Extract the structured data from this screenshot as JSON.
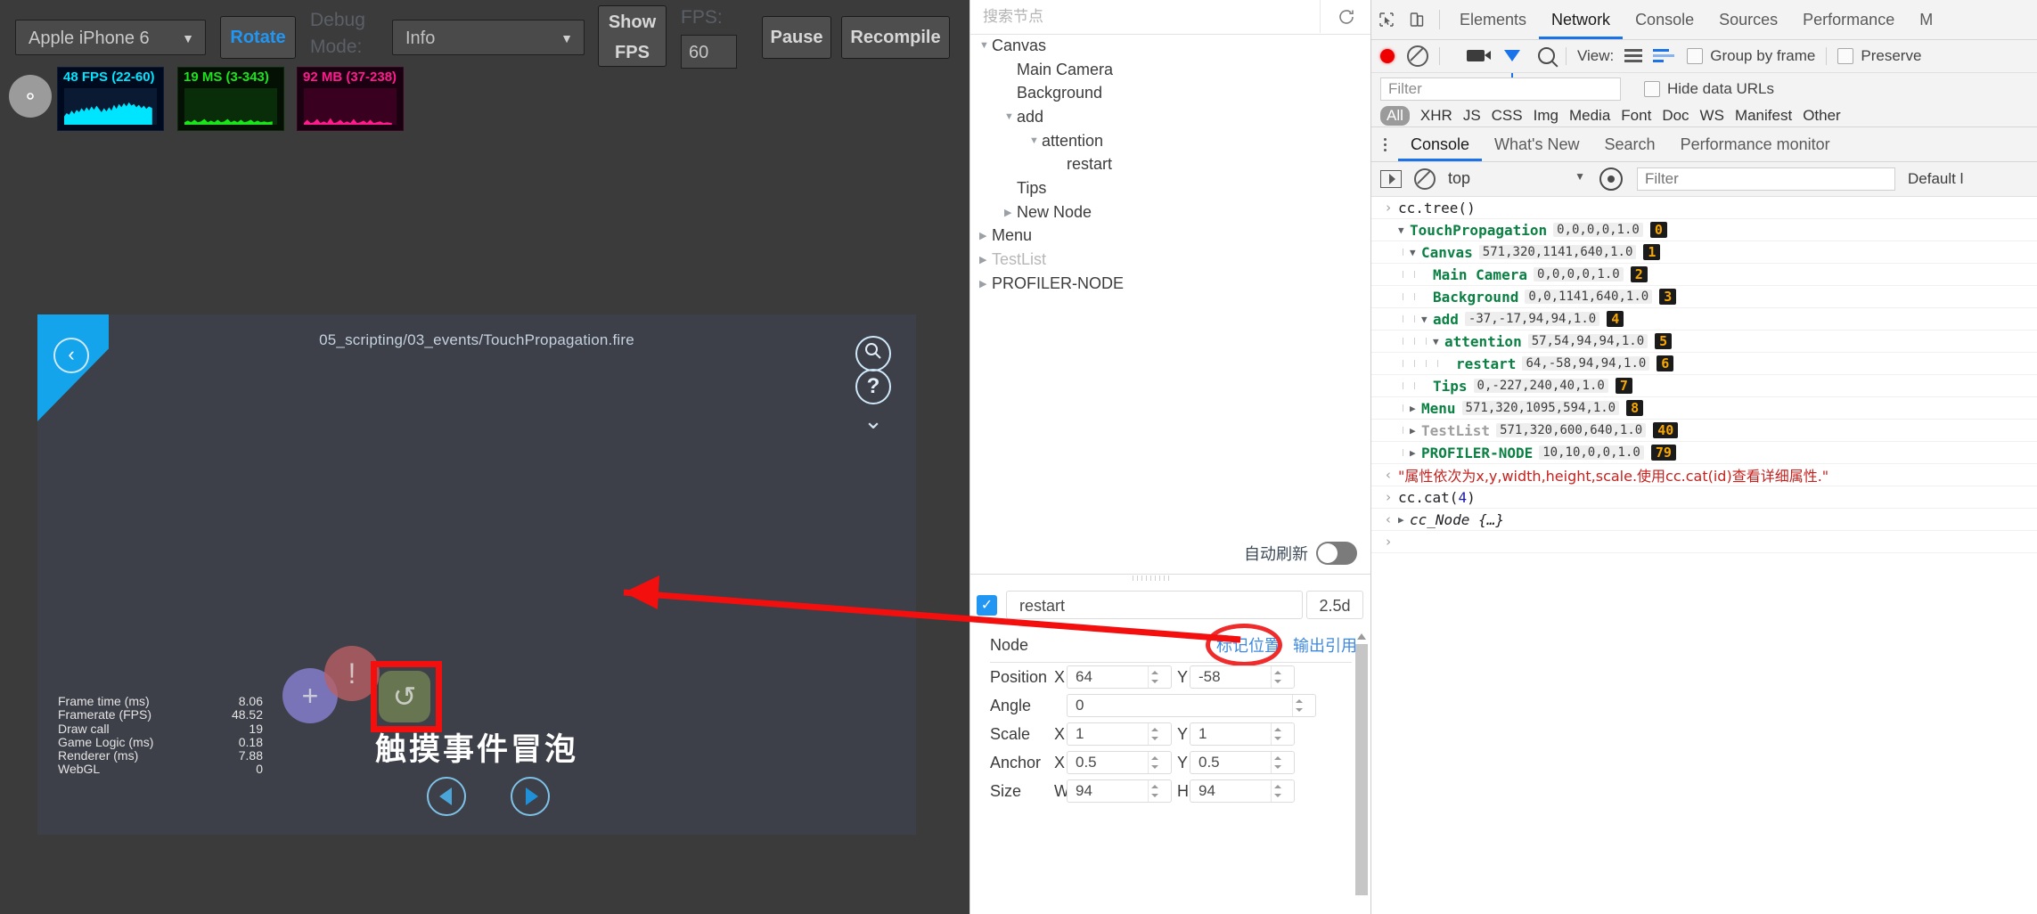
{
  "simulator": {
    "toolbar": {
      "device_value": "Apple iPhone 6",
      "rotate_label": "Rotate",
      "debug_mode_label": "Debug Mode:",
      "mode_value": "Info",
      "show_fps_label": "Show FPS",
      "fps_label": "FPS:",
      "fps_value": "60",
      "pause_label": "Pause",
      "recompile_label": "Recompile",
      "caret": "▼",
      "gear_icon": "gear-icon"
    },
    "stat_graphs": [
      {
        "caption": "48 FPS (22-60)",
        "color": "#00e5ff",
        "bg": "#000a1e"
      },
      {
        "caption": "19 MS (3-343)",
        "color": "#1ae51a",
        "bg": "#031003"
      },
      {
        "caption": "92 MB (37-238)",
        "color": "#ff1b8d",
        "bg": "#1a0010"
      }
    ],
    "game": {
      "scene_path": "05_scripting/03_events/TouchPropagation.fire",
      "back_icon": "chevron-left-icon",
      "search_icon": "search-icon",
      "help_icon": "question-mark-icon",
      "chevron_icon": "chevron-down-icon",
      "bubble_plus": "+",
      "bubble_exclaim": "!",
      "bubble_restart": "↺",
      "title": "触摸事件冒泡",
      "prev_icon": "triangle-left-icon",
      "next_icon": "triangle-right-icon",
      "stats": [
        {
          "key": "Frame time (ms)",
          "value": "8.06"
        },
        {
          "key": "Framerate (FPS)",
          "value": "48.52"
        },
        {
          "key": "Draw call",
          "value": "19"
        },
        {
          "key": "Game Logic (ms)",
          "value": "0.18"
        },
        {
          "key": "Renderer (ms)",
          "value": "7.88"
        },
        {
          "key": "WebGL",
          "value": "0"
        }
      ],
      "highlight_color": "#f40f0f"
    }
  },
  "inspector": {
    "search_placeholder": "搜索节点",
    "search_value": "",
    "refresh_icon": "refresh-icon",
    "tree": [
      {
        "label": "Canvas",
        "indent": 0,
        "twisty": "▼",
        "dim": false
      },
      {
        "label": "Main Camera",
        "indent": 1,
        "twisty": "",
        "dim": false
      },
      {
        "label": "Background",
        "indent": 1,
        "twisty": "",
        "dim": false
      },
      {
        "label": "add",
        "indent": 1,
        "twisty": "▼",
        "dim": false
      },
      {
        "label": "attention",
        "indent": 2,
        "twisty": "▼",
        "dim": false
      },
      {
        "label": "restart",
        "indent": 3,
        "twisty": "",
        "dim": false
      },
      {
        "label": "Tips",
        "indent": 1,
        "twisty": "",
        "dim": false
      },
      {
        "label": "New Node",
        "indent": 1,
        "twisty": "▶",
        "dim": false
      },
      {
        "label": "Menu",
        "indent": 0,
        "twisty": "▶",
        "dim": false
      },
      {
        "label": "TestList",
        "indent": 0,
        "twisty": "▶",
        "dim": true
      },
      {
        "label": "PROFILER-NODE",
        "indent": 0,
        "twisty": "▶",
        "dim": false
      }
    ],
    "auto_refresh_label": "自动刷新",
    "auto_refresh_on": false,
    "props": {
      "enabled": true,
      "check_glyph": "✓",
      "node_name": "restart",
      "dimension_mode": "2.5d",
      "section_title": "Node",
      "link_mark_position": "标记位置",
      "link_export_ref": "输出引用",
      "rows": [
        {
          "label": "Position",
          "fields": [
            {
              "axis": "X",
              "value": "64"
            },
            {
              "axis": "Y",
              "value": "-58"
            }
          ]
        },
        {
          "label": "Angle",
          "fields": [
            {
              "axis": "",
              "value": "0"
            }
          ]
        },
        {
          "label": "Scale",
          "fields": [
            {
              "axis": "X",
              "value": "1"
            },
            {
              "axis": "Y",
              "value": "1"
            }
          ]
        },
        {
          "label": "Anchor",
          "fields": [
            {
              "axis": "X",
              "value": "0.5"
            },
            {
              "axis": "Y",
              "value": "0.5"
            }
          ]
        },
        {
          "label": "Size",
          "fields": [
            {
              "axis": "W",
              "value": "94"
            },
            {
              "axis": "H",
              "value": "94"
            }
          ]
        }
      ]
    }
  },
  "devtools": {
    "inspect_icon": "cursor-select-icon",
    "device_icon": "device-toolbar-icon",
    "tabs": [
      {
        "label": "Elements",
        "active": false
      },
      {
        "label": "Network",
        "active": true
      },
      {
        "label": "Console",
        "active": false
      },
      {
        "label": "Sources",
        "active": false
      },
      {
        "label": "Performance",
        "active": false
      },
      {
        "label": "M",
        "active": false
      }
    ],
    "network_controls": {
      "record_icon": "record-icon",
      "clear_icon": "clear-icon",
      "capture_screenshots_icon": "camera-icon",
      "filter_icon": "funnel-icon",
      "search_icon": "search-icon",
      "view_label": "View:",
      "list_view_icon": "list-view-icon",
      "waterfall_view_icon": "waterfall-view-icon",
      "group_by_frame_label": "Group by frame",
      "group_by_frame_checked": false,
      "preserve_label": "Preserve",
      "preserve_checked": false
    },
    "filter_placeholder": "Filter",
    "filter_value": "",
    "hide_data_urls_label": "Hide data URLs",
    "hide_data_urls_checked": false,
    "resource_types": [
      "All",
      "XHR",
      "JS",
      "CSS",
      "Img",
      "Media",
      "Font",
      "Doc",
      "WS",
      "Manifest",
      "Other"
    ],
    "drawer_tabs": [
      {
        "label": "Console",
        "active": true
      },
      {
        "label": "What's New",
        "active": false
      },
      {
        "label": "Search",
        "active": false
      },
      {
        "label": "Performance monitor",
        "active": false
      }
    ],
    "console_controls": {
      "exec_icon": "execution-context-icon",
      "clear_icon": "clear-console-icon",
      "context_value": "top",
      "context_caret": "▼",
      "eye_icon": "live-expression-icon",
      "filter_placeholder": "Filter",
      "filter_value": "",
      "level_label": "Default l"
    },
    "console_lines": [
      {
        "type": "input",
        "gutter": "›",
        "text": "cc.tree()"
      },
      {
        "type": "node",
        "gutter": "",
        "twisty": "▼",
        "depth": 0,
        "name": "TouchPropagation",
        "meta": "0,0,0,0,1.0",
        "id": "0",
        "dim": false
      },
      {
        "type": "node",
        "gutter": "",
        "twisty": "▼",
        "depth": 1,
        "name": "Canvas",
        "meta": "571,320,1141,640,1.0",
        "id": "1",
        "dim": false
      },
      {
        "type": "node",
        "gutter": "",
        "twisty": "",
        "depth": 2,
        "name": "Main Camera",
        "meta": "0,0,0,0,1.0",
        "id": "2",
        "dim": false
      },
      {
        "type": "node",
        "gutter": "",
        "twisty": "",
        "depth": 2,
        "name": "Background",
        "meta": "0,0,1141,640,1.0",
        "id": "3",
        "dim": false
      },
      {
        "type": "node",
        "gutter": "",
        "twisty": "▼",
        "depth": 2,
        "name": "add",
        "meta": "-37,-17,94,94,1.0",
        "id": "4",
        "dim": false
      },
      {
        "type": "node",
        "gutter": "",
        "twisty": "▼",
        "depth": 3,
        "name": "attention",
        "meta": "57,54,94,94,1.0",
        "id": "5",
        "dim": false
      },
      {
        "type": "node",
        "gutter": "",
        "twisty": "",
        "depth": 4,
        "name": "restart",
        "meta": "64,-58,94,94,1.0",
        "id": "6",
        "dim": false
      },
      {
        "type": "node",
        "gutter": "",
        "twisty": "",
        "depth": 2,
        "name": "Tips",
        "meta": "0,-227,240,40,1.0",
        "id": "7",
        "dim": false
      },
      {
        "type": "node",
        "gutter": "",
        "twisty": "▶",
        "depth": 1,
        "name": "Menu",
        "meta": "571,320,1095,594,1.0",
        "id": "8",
        "dim": false
      },
      {
        "type": "node",
        "gutter": "",
        "twisty": "▶",
        "depth": 1,
        "name": "TestList",
        "meta": "571,320,600,640,1.0",
        "id": "40",
        "dim": true
      },
      {
        "type": "node",
        "gutter": "",
        "twisty": "▶",
        "depth": 1,
        "name": "PROFILER-NODE",
        "meta": "10,10,0,0,1.0",
        "id": "79",
        "dim": false
      },
      {
        "type": "error",
        "gutter": "‹",
        "text": "\"属性依次为x,y,width,height,scale.使用cc.cat(id)查看详细属性.\""
      },
      {
        "type": "input",
        "gutter": "›",
        "text": "cc.cat(",
        "num": "4",
        "text2": ")"
      },
      {
        "type": "result",
        "gutter": "‹",
        "twisty": "▶",
        "text": "cc_Node {…}"
      },
      {
        "type": "prompt",
        "gutter": "›",
        "text": ""
      }
    ]
  }
}
